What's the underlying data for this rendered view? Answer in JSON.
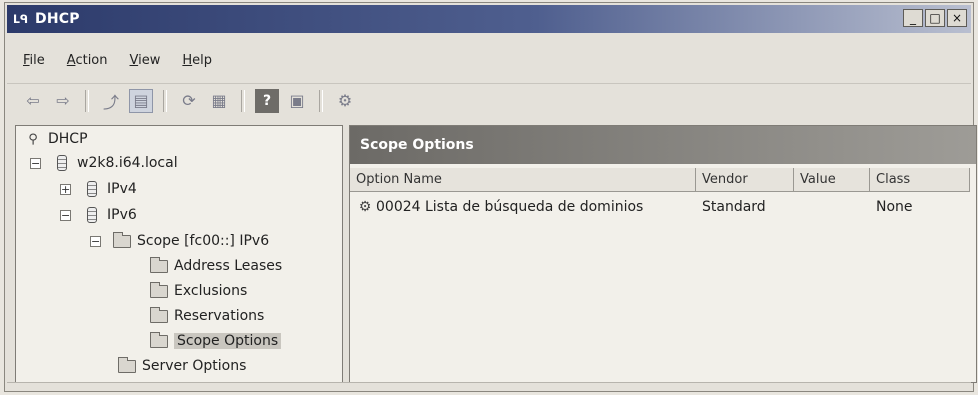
{
  "window": {
    "title": "DHCP",
    "title_icon": "dhcp-logo-icon",
    "controls": [
      "_",
      "□",
      "×"
    ]
  },
  "menu": [
    {
      "key": "F",
      "rest": "ile"
    },
    {
      "key": "A",
      "rest": "ction"
    },
    {
      "key": "V",
      "rest": "iew"
    },
    {
      "key": "H",
      "rest": "elp"
    }
  ],
  "toolbar": {
    "icons": [
      "back-arrow-icon",
      "forward-arrow-icon",
      "up-level-icon",
      "show-hide-tree-icon",
      "refresh-icon",
      "export-list-icon",
      "help-icon",
      "console-window-icon",
      "dhcp-properties-icon"
    ]
  },
  "tree": {
    "root": "DHCP",
    "server": "w2k8.i64.local",
    "ipv4": "IPv4",
    "ipv6": "IPv6",
    "scope": "Scope [fc00::] IPv6",
    "address_leases": "Address Leases",
    "exclusions": "Exclusions",
    "reservations": "Reservations",
    "scope_options": "Scope Options",
    "server_options": "Server Options"
  },
  "pane": {
    "title": "Scope Options",
    "columns": [
      "Option Name",
      "Vendor",
      "Value",
      "Class"
    ],
    "rows": [
      {
        "option_name": "00024 Lista de búsqueda de dominios",
        "vendor": "Standard",
        "value": "",
        "class": "None"
      }
    ]
  }
}
